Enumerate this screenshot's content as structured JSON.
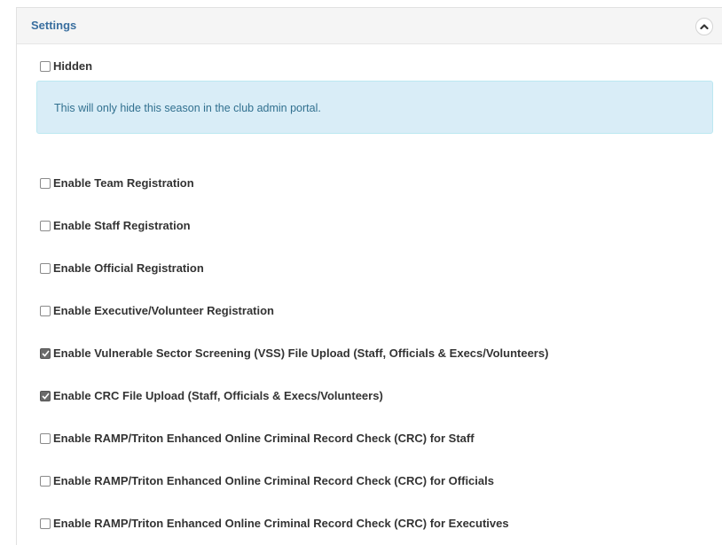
{
  "panel": {
    "title": "Settings"
  },
  "hidden_option": {
    "label": "Hidden",
    "checked": false
  },
  "info": {
    "text": "This will only hide this season in the club admin portal."
  },
  "options": [
    {
      "label": "Enable Team Registration",
      "checked": false
    },
    {
      "label": "Enable Staff Registration",
      "checked": false
    },
    {
      "label": "Enable Official Registration",
      "checked": false
    },
    {
      "label": "Enable Executive/Volunteer Registration",
      "checked": false
    },
    {
      "label": "Enable Vulnerable Sector Screening (VSS) File Upload (Staff, Officials & Execs/Volunteers)",
      "checked": true
    },
    {
      "label": "Enable CRC File Upload (Staff, Officials & Execs/Volunteers)",
      "checked": true
    },
    {
      "label": "Enable RAMP/Triton Enhanced Online Criminal Record Check (CRC) for Staff",
      "checked": false
    },
    {
      "label": "Enable RAMP/Triton Enhanced Online Criminal Record Check (CRC) for Officials",
      "checked": false
    },
    {
      "label": "Enable RAMP/Triton Enhanced Online Criminal Record Check (CRC) for Executives",
      "checked": false
    }
  ],
  "icons": {
    "collapse": "chevron-up-icon",
    "checkbox_mark": "check-icon"
  },
  "colors": {
    "title": "#3a6f9f",
    "info_bg": "#d9edf7",
    "info_text": "#31708f"
  }
}
